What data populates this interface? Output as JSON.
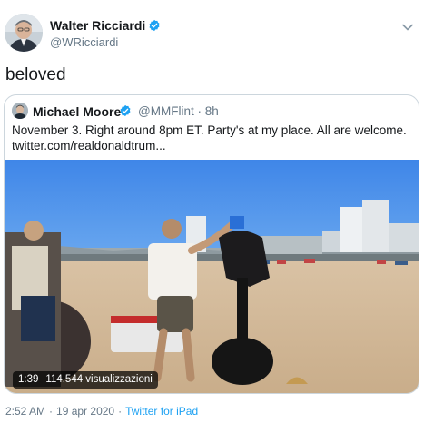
{
  "author": {
    "name": "Walter Ricciardi",
    "handle": "@WRicciardi",
    "verified": true
  },
  "tweet": {
    "text": "beloved"
  },
  "quoted_tweet": {
    "name": "Michael Moore",
    "handle": "@MMFlint · 8h",
    "verified": true,
    "text_line1": "November 3.  Right around 8pm ET. Party's at my place. All are welcome.",
    "text_line2": "twitter.com/realdonaldtrum..."
  },
  "video": {
    "duration": "1:39",
    "views": "114.544 visualizzazioni"
  },
  "footer": {
    "time": "2:52 AM",
    "date": "19 apr 2020",
    "separator": "·",
    "source": "Twitter for iPad"
  },
  "colors": {
    "verified_blue": "#1da1f2",
    "link_blue": "#1da1f2",
    "secondary_text": "#657786",
    "card_border": "#ccd6dd"
  },
  "icons": {
    "verified": "verified-badge-icon",
    "caret": "chevron-down-icon"
  }
}
